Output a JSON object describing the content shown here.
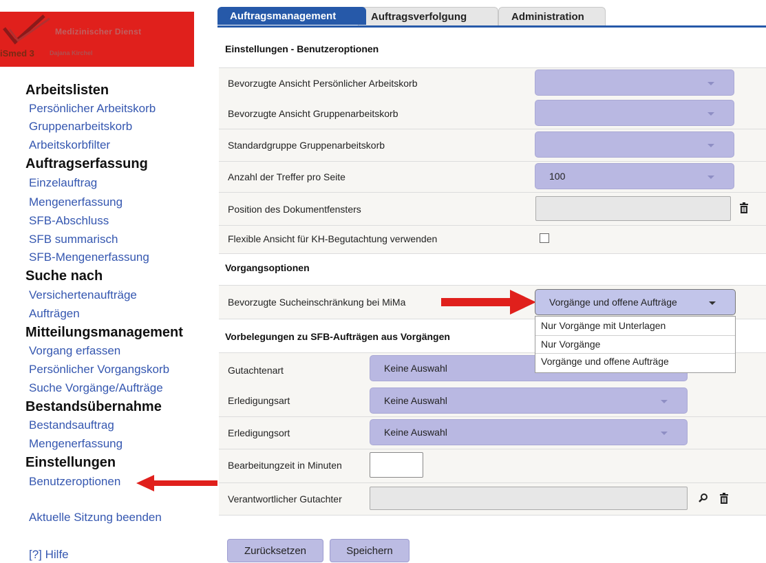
{
  "logo": {
    "org": "Medizinischer Dienst",
    "app": "iSmed 3",
    "user": "Dajana Kirchel"
  },
  "sidebar": {
    "groups": [
      {
        "title": "Arbeitslisten",
        "items": [
          "Persönlicher Arbeitskorb",
          "Gruppenarbeitskorb",
          "Arbeitskorbfilter"
        ]
      },
      {
        "title": "Auftragserfassung",
        "items": [
          "Einzelauftrag",
          "Mengenerfassung",
          "SFB-Abschluss",
          "SFB summarisch",
          "SFB-Mengenerfassung"
        ]
      },
      {
        "title": "Suche nach",
        "items": [
          "Versichertenaufträge",
          "Aufträgen"
        ]
      },
      {
        "title": "Mitteilungsmanagement",
        "items": [
          "Vorgang erfassen",
          "Persönlicher Vorgangskorb",
          "Suche Vorgänge/Aufträge"
        ]
      },
      {
        "title": "Bestandsübernahme",
        "items": [
          "Bestandsauftrag",
          "Mengenerfassung"
        ]
      },
      {
        "title": "Einstellungen",
        "items": [
          "Benutzeroptionen"
        ]
      }
    ],
    "logout": "Aktuelle Sitzung beenden",
    "help": "[?] Hilfe"
  },
  "tabs": [
    {
      "label": "Auftragsmanagement",
      "active": true
    },
    {
      "label": "Auftragsverfolgung",
      "active": false
    },
    {
      "label": "Administration",
      "active": false
    }
  ],
  "settings": {
    "title": "Einstellungen - Benutzeroptionen",
    "rows": {
      "ansicht_persoenlich": {
        "label": "Bevorzugte Ansicht Persönlicher Arbeitskorb",
        "value": ""
      },
      "ansicht_gruppe": {
        "label": "Bevorzugte Ansicht Gruppenarbeitskorb",
        "value": ""
      },
      "standardgruppe": {
        "label": "Standardgruppe Gruppenarbeitskorb",
        "value": ""
      },
      "treffer": {
        "label": "Anzahl der Treffer pro Seite",
        "value": "100"
      },
      "position": {
        "label": "Position des Dokumentfensters",
        "value": ""
      },
      "flexible": {
        "label": "Flexible Ansicht für KH-Begutachtung verwenden",
        "checked": false
      }
    }
  },
  "vorgang": {
    "title": "Vorgangsoptionen",
    "label": "Bevorzugte Sucheinschränkung bei MiMa",
    "selected": "Vorgänge und offene Aufträge",
    "options": [
      "Nur Vorgänge mit Unterlagen",
      "Nur Vorgänge",
      "Vorgänge und offene Aufträge"
    ]
  },
  "sfb": {
    "title": "Vorbelegungen zu SFB-Aufträgen aus Vorgängen",
    "gutachtenart": {
      "label": "Gutachtenart",
      "value": "Keine Auswahl"
    },
    "erledigungsart": {
      "label": "Erledigungsart",
      "value": "Keine Auswahl"
    },
    "erledigungsort": {
      "label": "Erledigungsort",
      "value": "Keine Auswahl"
    },
    "bearbeitungszeit": {
      "label": "Bearbeitungzeit in Minuten",
      "value": ""
    },
    "gutachter": {
      "label": "Verantwortlicher Gutachter",
      "value": ""
    }
  },
  "buttons": {
    "reset": "Zurücksetzen",
    "save": "Speichern"
  },
  "colors": {
    "accent": "#2659a9",
    "select": "#b9b8e2",
    "logo_bg": "#e0201c",
    "arrow": "#e0201c",
    "link": "#3557b0"
  }
}
